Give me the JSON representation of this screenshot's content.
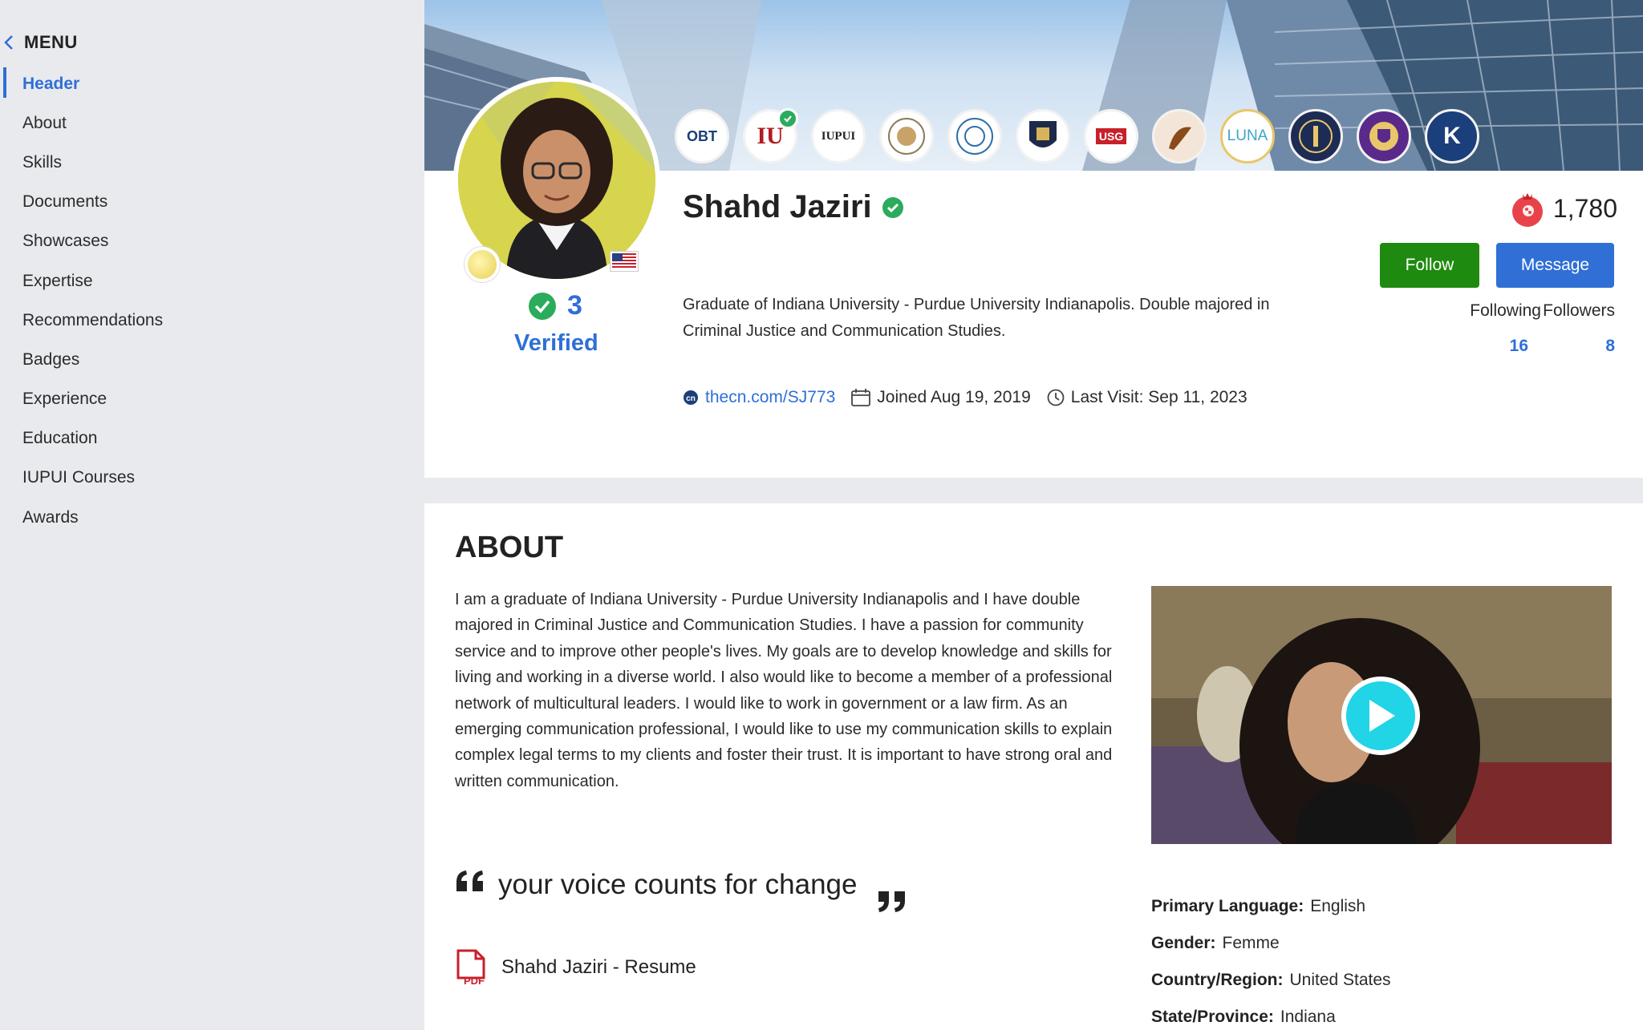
{
  "sidebar": {
    "menu_title": "MENU",
    "items": [
      {
        "label": "Header"
      },
      {
        "label": "About"
      },
      {
        "label": "Skills"
      },
      {
        "label": "Documents"
      },
      {
        "label": "Showcases"
      },
      {
        "label": "Expertise"
      },
      {
        "label": "Recommendations"
      },
      {
        "label": "Badges"
      },
      {
        "label": "Experience"
      },
      {
        "label": "Education"
      },
      {
        "label": "IUPUI Courses"
      },
      {
        "label": "Awards"
      }
    ],
    "active_index": 0
  },
  "profile": {
    "name": "Shahd Jaziri",
    "verified_count": "3",
    "verified_label": "Verified",
    "bio": "Graduate of Indiana University - Purdue University Indianapolis. Double majored in Criminal Justice and Communication Studies.",
    "link": "thecn.com/SJ773",
    "joined": "Joined Aug 19, 2019",
    "last_visit": "Last Visit: Sep 11, 2023",
    "points": "1,780",
    "follow_label": "Follow",
    "message_label": "Message",
    "following_label": "Following",
    "following_count": "16",
    "followers_label": "Followers",
    "followers_count": "8",
    "badges": [
      "OBT",
      "IU",
      "IUPUI",
      "",
      "",
      "",
      "USG",
      "",
      "LUNA",
      "",
      "",
      "K"
    ]
  },
  "about": {
    "title": "ABOUT",
    "text": "I am a graduate of Indiana University - Purdue University Indianapolis and I have double majored in Criminal Justice and Communication Studies. I have a passion for community service and to improve other people's lives. My goals are to develop knowledge and skills for living and working in a diverse world. I also would like to become a member of a professional network of multicultural leaders. I would like to work in government or a law firm. As an emerging communication professional, I would like to use my communication skills to explain complex legal terms to my clients and foster their trust. It is important to have strong oral and written communication.",
    "quote": "your voice counts for change",
    "resume": "Shahd Jaziri - Resume",
    "pdf_label": "PDF",
    "info": [
      {
        "label": "Primary Language:",
        "value": "English"
      },
      {
        "label": "Gender:",
        "value": "Femme"
      },
      {
        "label": "Country/Region:",
        "value": "United States"
      },
      {
        "label": "State/Province:",
        "value": "Indiana"
      }
    ]
  },
  "colors": {
    "accent": "#2f6fd6",
    "follow": "#1e8a0f",
    "verified_green": "#2bab5c",
    "points_red": "#e8434b",
    "play": "#21d4e6"
  }
}
